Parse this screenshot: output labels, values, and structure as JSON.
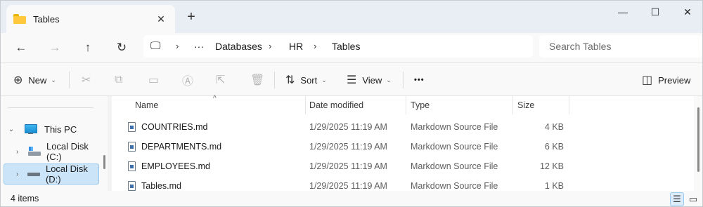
{
  "tab": {
    "title": "Tables",
    "close_icon": "✕",
    "new_tab_icon": "+"
  },
  "window_controls": {
    "minimize": "—",
    "maximize": "☐",
    "close": "✕"
  },
  "nav": {
    "back_icon": "←",
    "forward_icon": "→",
    "up_icon": "↑",
    "refresh_icon": "↻"
  },
  "address": {
    "computer_icon": "🖵",
    "overflow": "···",
    "chevron": "›",
    "segments": [
      "Databases",
      "HR",
      "Tables"
    ]
  },
  "search": {
    "placeholder": "Search Tables"
  },
  "toolbar": {
    "new_label": "New",
    "sort_label": "Sort",
    "view_label": "View",
    "preview_label": "Preview",
    "more_icon": "•••",
    "caret": "⌄"
  },
  "sidebar": {
    "items": [
      {
        "label": "This PC",
        "expand": "⌄"
      },
      {
        "label": "Local Disk (C:)",
        "expand": "›"
      },
      {
        "label": "Local Disk (D:)",
        "expand": "›"
      }
    ]
  },
  "files": {
    "columns": {
      "name": "Name",
      "date": "Date modified",
      "type": "Type",
      "size": "Size"
    },
    "sort_caret": "^",
    "rows": [
      {
        "name": "COUNTRIES.md",
        "date": "1/29/2025 11:19 AM",
        "type": "Markdown Source File",
        "size": "4 KB"
      },
      {
        "name": "DEPARTMENTS.md",
        "date": "1/29/2025 11:19 AM",
        "type": "Markdown Source File",
        "size": "6 KB"
      },
      {
        "name": "EMPLOYEES.md",
        "date": "1/29/2025 11:19 AM",
        "type": "Markdown Source File",
        "size": "12 KB"
      },
      {
        "name": "Tables.md",
        "date": "1/29/2025 11:19 AM",
        "type": "Markdown Source File",
        "size": "1 KB"
      }
    ]
  },
  "status": {
    "item_count": "4 items"
  },
  "colors": {
    "accent": "#0067c0",
    "selection": "#cce4f7",
    "folder": "#ffc83d"
  }
}
